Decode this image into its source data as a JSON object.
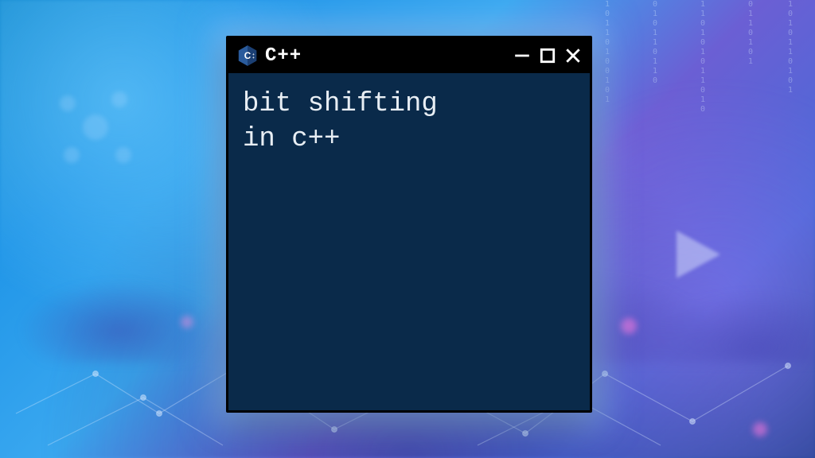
{
  "window": {
    "title": "C++",
    "content_line1": "bit shifting",
    "content_line2": "in c++"
  },
  "colors": {
    "terminal_bg": "#0a2a4a",
    "title_bg": "#000000",
    "text": "#e8eef4"
  }
}
